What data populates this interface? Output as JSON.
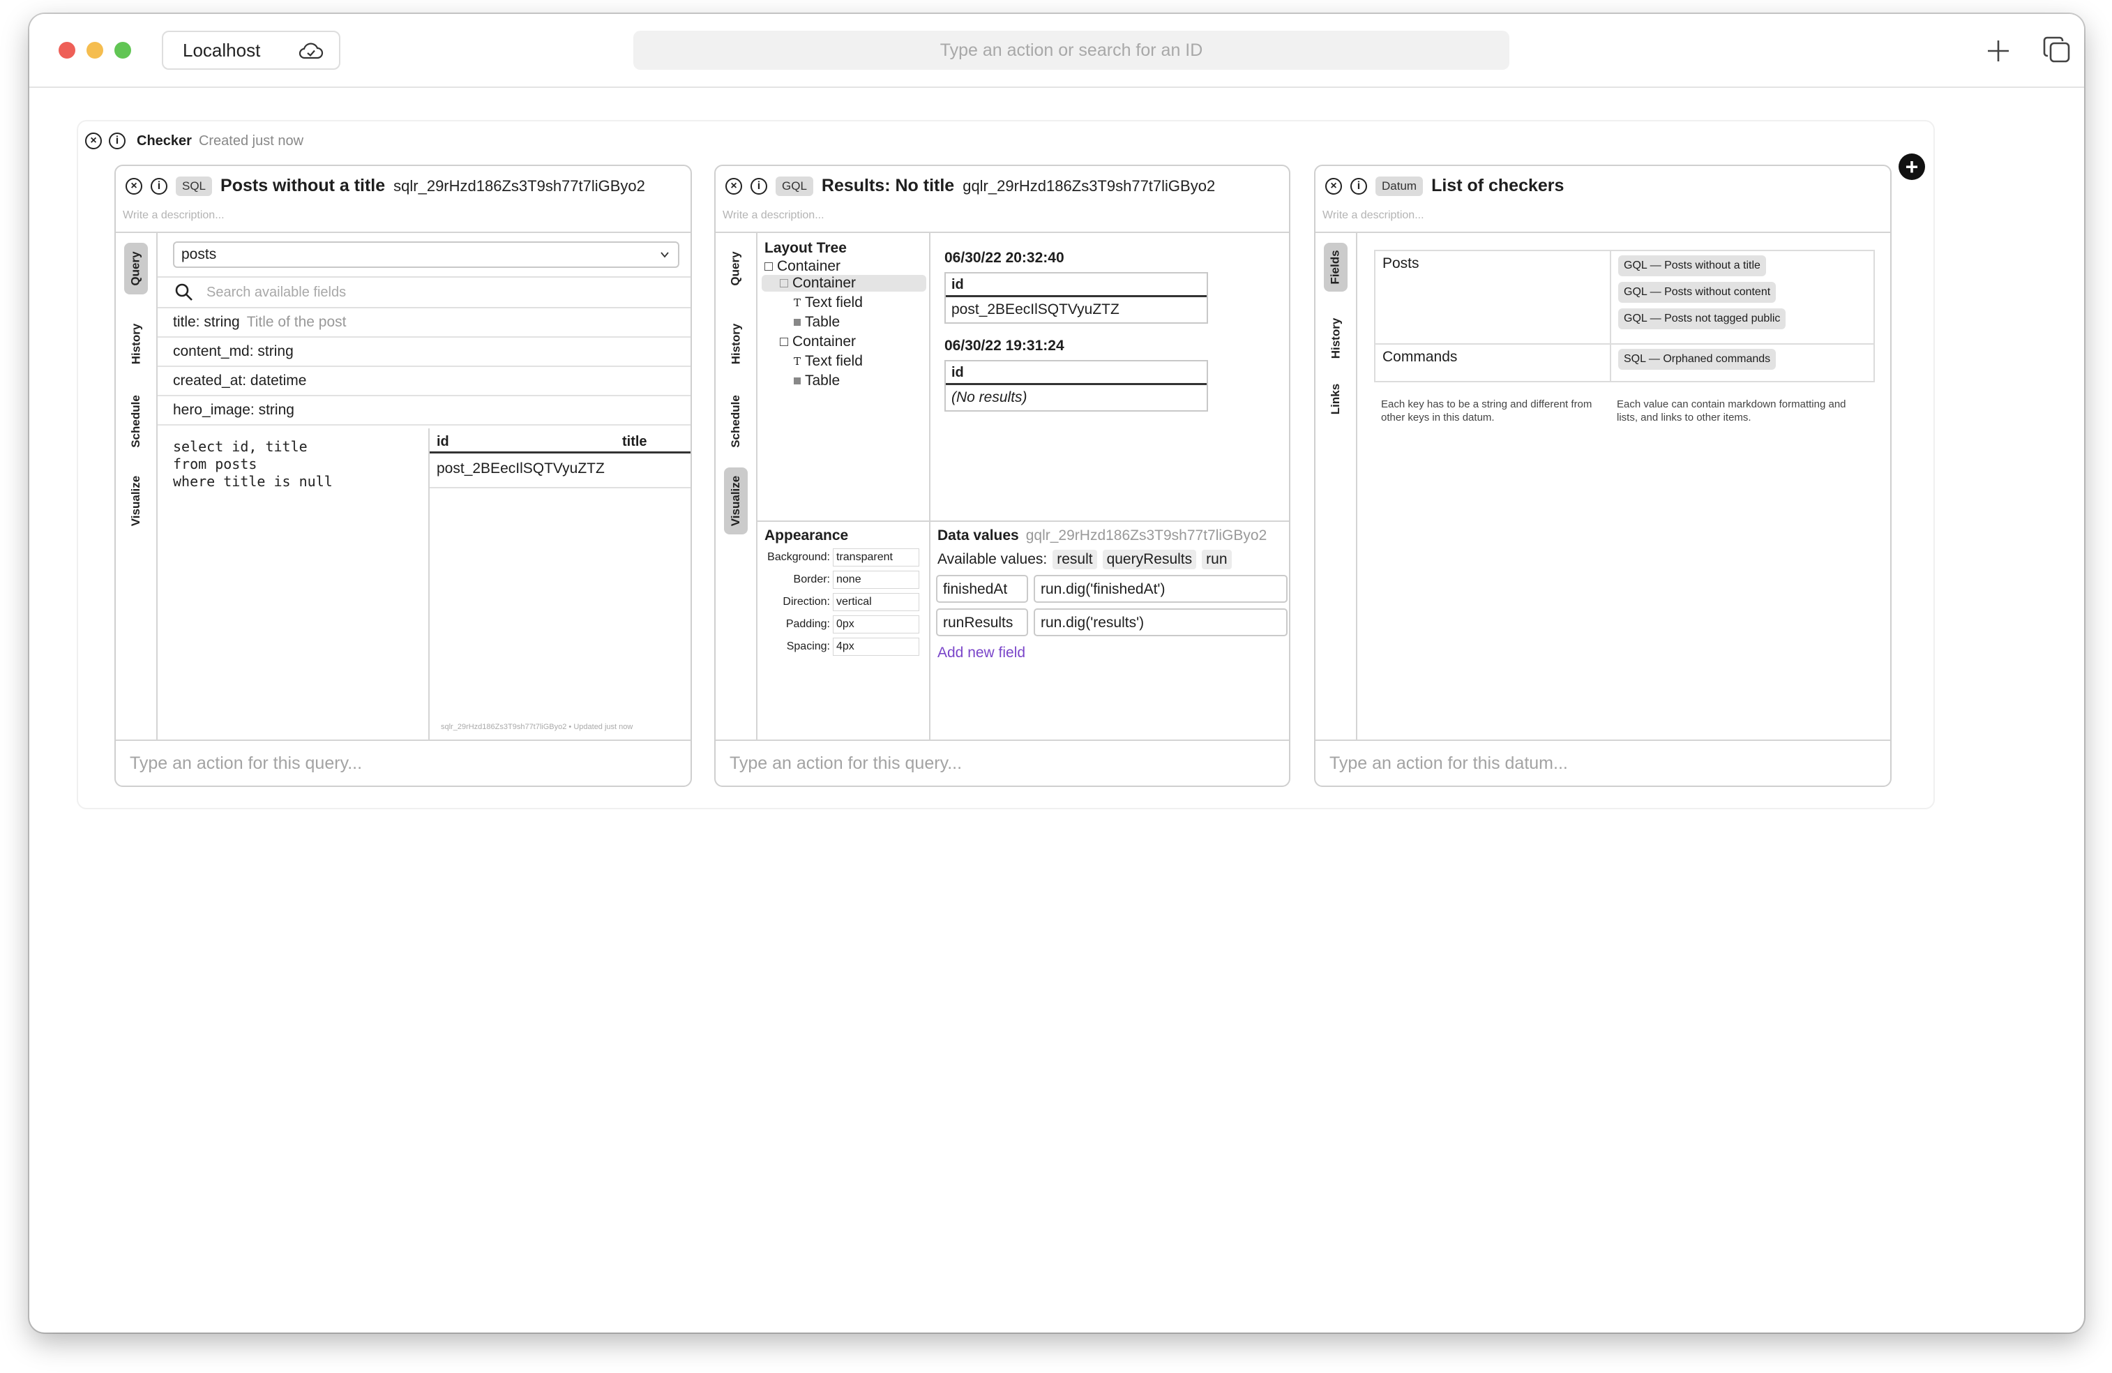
{
  "titlebar": {
    "host": "Localhost",
    "search_placeholder": "Type an action or search for an ID"
  },
  "checker": {
    "name": "Checker",
    "meta": "Created just now"
  },
  "panels": {
    "sql": {
      "badge": "SQL",
      "title": "Posts without a title",
      "id": "sqlr_29rHzd186Zs3T9sh77t7liGByo2",
      "description_placeholder": "Write a description...",
      "tabs": [
        "Query",
        "History",
        "Schedule",
        "Visualize"
      ],
      "active_tab": "Query",
      "table_select": "posts",
      "field_search_placeholder": "Search available fields",
      "fields": [
        {
          "name": "title: string",
          "desc": "Title of the post"
        },
        {
          "name": "content_md: string",
          "desc": ""
        },
        {
          "name": "created_at: datetime",
          "desc": ""
        },
        {
          "name": "hero_image: string",
          "desc": ""
        }
      ],
      "query": "select id, title\nfrom posts\nwhere title is null",
      "results": {
        "columns": [
          "id",
          "title"
        ],
        "rows": [
          [
            "post_2BEecIlSQTVyuZTZ",
            ""
          ]
        ],
        "footer": "sqlr_29rHzd186Zs3T9sh77t7liGByo2 • Updated just now"
      },
      "action_placeholder": "Type an action for this query..."
    },
    "gql": {
      "badge": "GQL",
      "title": "Results: No title",
      "id": "gqlr_29rHzd186Zs3T9sh77t7liGByo2",
      "description_placeholder": "Write a description...",
      "tabs": [
        "Query",
        "History",
        "Schedule",
        "Visualize"
      ],
      "active_tab": "Visualize",
      "layout_tree": {
        "title": "Layout Tree",
        "nodes": [
          {
            "label": "Container",
            "kind": "container"
          },
          {
            "label": "Container",
            "kind": "container"
          },
          {
            "label": "Text field",
            "kind": "text"
          },
          {
            "label": "Table",
            "kind": "table"
          },
          {
            "label": "Container",
            "kind": "container"
          },
          {
            "label": "Text field",
            "kind": "text"
          },
          {
            "label": "Table",
            "kind": "table"
          }
        ]
      },
      "runs": [
        {
          "date": "06/30/22 20:32:40",
          "column": "id",
          "value": "post_2BEecIlSQTVyuZTZ"
        },
        {
          "date": "06/30/22 19:31:24",
          "column": "id",
          "value": "(No results)"
        }
      ],
      "appearance": {
        "title": "Appearance",
        "rows": [
          {
            "label": "Background:",
            "value": "transparent"
          },
          {
            "label": "Border:",
            "value": "none"
          },
          {
            "label": "Direction:",
            "value": "vertical"
          },
          {
            "label": "Padding:",
            "value": "0px"
          },
          {
            "label": "Spacing:",
            "value": "4px"
          }
        ]
      },
      "data_values": {
        "title": "Data values",
        "id": "gqlr_29rHzd186Zs3T9sh77t7liGByo2",
        "available_label": "Available values:",
        "available": [
          "result",
          "queryResults",
          "run"
        ],
        "fields": [
          {
            "key": "finishedAt",
            "value": "run.dig('finishedAt')"
          },
          {
            "key": "runResults",
            "value": "run.dig('results')"
          }
        ],
        "add_label": "Add new field"
      },
      "action_placeholder": "Type an action for this query..."
    },
    "datum": {
      "badge": "Datum",
      "title": "List of checkers",
      "description_placeholder": "Write a description...",
      "tabs": [
        "Fields",
        "History",
        "Links"
      ],
      "active_tab": "Fields",
      "rows": [
        {
          "key": "Posts",
          "values": [
            "GQL — Posts without a title",
            "GQL — Posts without content",
            "GQL — Posts not tagged public"
          ]
        },
        {
          "key": "Commands",
          "values": [
            "SQL — Orphaned commands"
          ]
        }
      ],
      "key_hint": "Each key has to be a string and different from other keys in this datum.",
      "value_hint": "Each value can contain markdown formatting and lists, and links to other items.",
      "action_placeholder": "Type an action for this datum..."
    }
  }
}
